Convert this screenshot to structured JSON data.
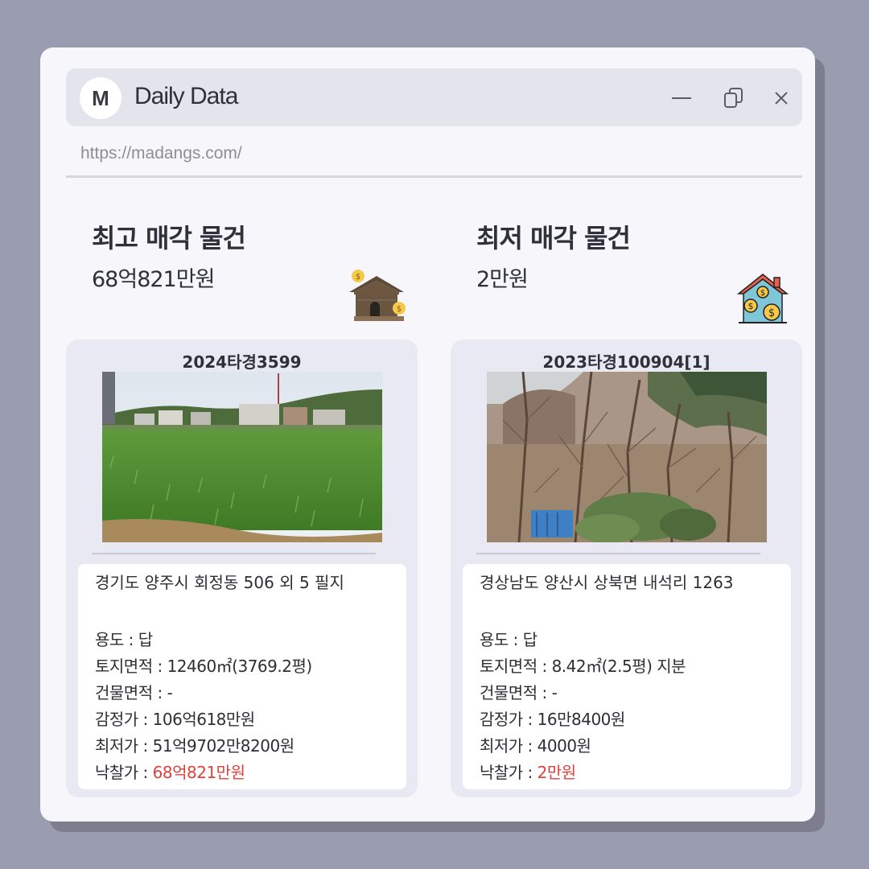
{
  "window": {
    "logo_letter": "M",
    "title": "Daily Data",
    "url": "https://madangs.com/"
  },
  "highest": {
    "heading": "최고 매각 물건",
    "price": "68억821만원",
    "case_no": "2024타경3599",
    "address": "경기도 양주시 회정동 506 외 5 필지",
    "usage_label": "용도 : ",
    "usage": "답",
    "land_label": "토지면적 : ",
    "land": "12460㎡(3769.2평)",
    "building_label": "건물면적 :  ",
    "building": "-",
    "appraisal_label": "감정가 : ",
    "appraisal": "106억618만원",
    "minimum_label": "최저가 : ",
    "minimum": "51억9702만8200원",
    "winning_label": "낙찰가 : ",
    "winning": "68억821만원"
  },
  "lowest": {
    "heading": "최저 매각 물건",
    "price": "2만원",
    "case_no": "2023타경100904[1]",
    "address": "경상남도 양산시 상북면 내석리 1263",
    "usage_label": "용도 :  ",
    "usage": "답",
    "land_label": "토지면적 : ",
    "land": "8.42㎡(2.5평) 지분",
    "building_label": "건물면적 : ",
    "building": "-",
    "appraisal_label": "감정가 : ",
    "appraisal": "16만8400원",
    "minimum_label": "최저가 : ",
    "minimum": "4000원",
    "winning_label": "낙찰가 : ",
    "winning": "2만원"
  },
  "colors": {
    "accent_red": "#e0413d",
    "background": "#9a9caf",
    "window": "#f6f6fb"
  }
}
